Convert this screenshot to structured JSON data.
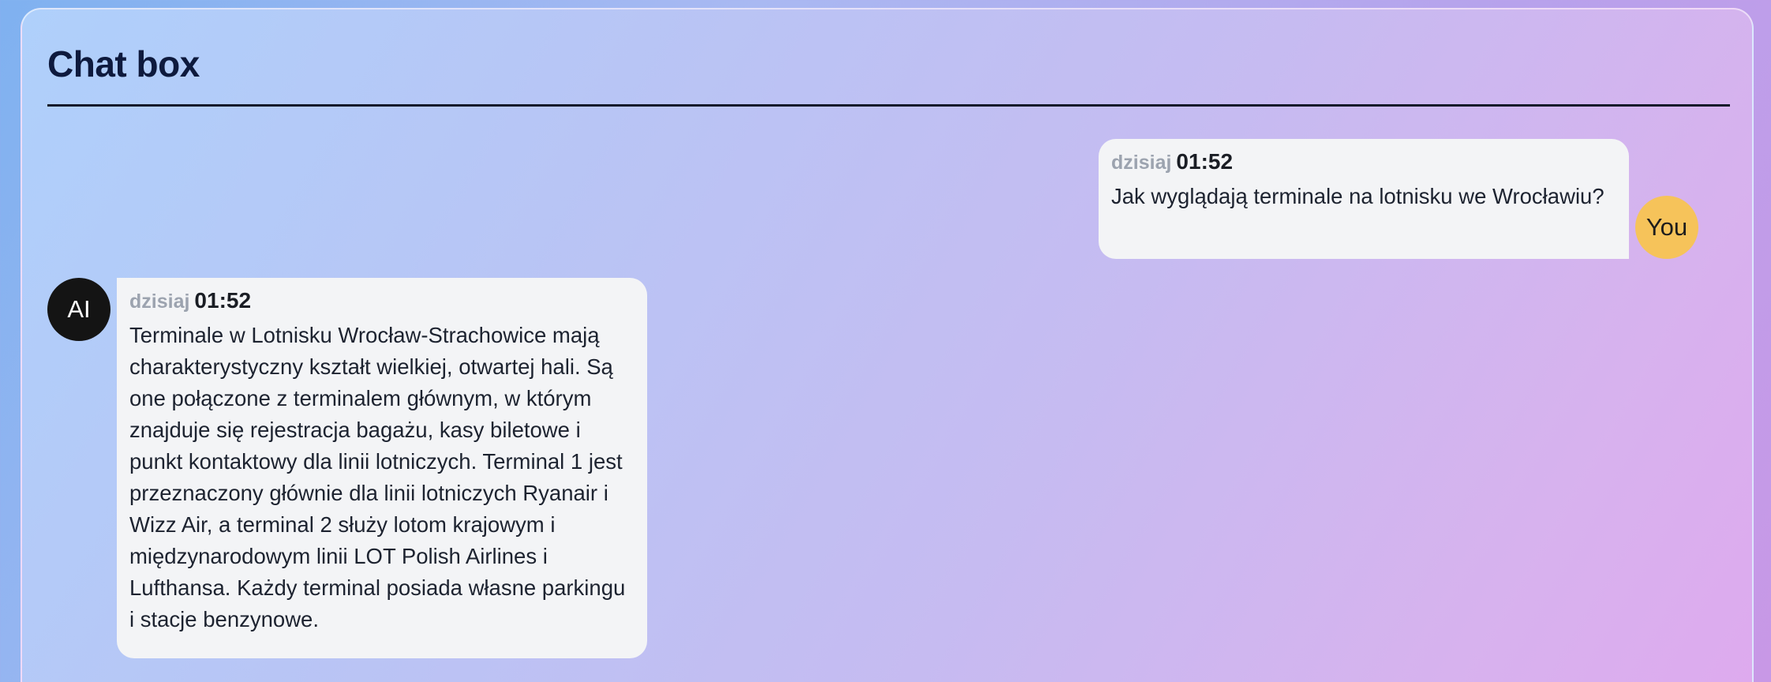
{
  "header": {
    "title": "Chat box"
  },
  "messages": [
    {
      "role": "user",
      "avatar_label": "You",
      "day": "dzisiaj",
      "time": "01:52",
      "text": "Jak wyglądają terminale na lotnisku we Wrocławiu?"
    },
    {
      "role": "ai",
      "avatar_label": "AI",
      "day": "dzisiaj",
      "time": "01:52",
      "text": "Terminale w Lotnisku Wrocław-Strachowice mają charakterystyczny kształt wielkiej, otwartej hali. Są one połączone z terminalem głównym, w którym znajduje się rejestracja bagażu, kasy biletowe i punkt kontaktowy dla linii lotniczych. Terminal 1 jest przeznaczony głównie dla linii lotniczych Ryanair i Wizz Air, a terminal 2 służy lotom krajowym i międzynarodowym linii LOT Polish Airlines i Lufthansa. Każdy terminal posiada własne parkingu i stacje benzynowe."
    }
  ],
  "colors": {
    "user_avatar": "#f6c35a",
    "ai_avatar": "#141414",
    "bubble": "#f3f4f6",
    "title": "#0e1a3d"
  }
}
